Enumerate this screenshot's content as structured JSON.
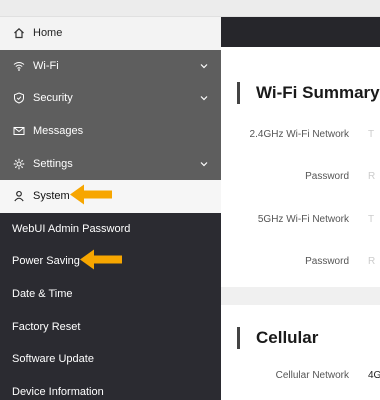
{
  "sidebar": {
    "items": [
      {
        "label": "Home",
        "icon": "home-icon"
      },
      {
        "label": "Wi-Fi",
        "icon": "wifi-icon"
      },
      {
        "label": "Security",
        "icon": "shield-icon"
      },
      {
        "label": "Messages",
        "icon": "envelope-icon"
      },
      {
        "label": "Settings",
        "icon": "gear-icon"
      },
      {
        "label": "System",
        "icon": "person-icon"
      },
      {
        "label": "WebUI Admin Password"
      },
      {
        "label": "Power Saving"
      },
      {
        "label": "Date & Time"
      },
      {
        "label": "Factory Reset"
      },
      {
        "label": "Software Update"
      },
      {
        "label": "Device Information"
      }
    ]
  },
  "wifi_summary": {
    "title": "Wi-Fi Summary",
    "rows": [
      {
        "label": "2.4GHz Wi-Fi Network",
        "value": "T"
      },
      {
        "label": "Password",
        "value": "R"
      },
      {
        "label": "5GHz Wi-Fi Network",
        "value": "T"
      },
      {
        "label": "Password",
        "value": "R"
      }
    ]
  },
  "cellular": {
    "title": "Cellular",
    "rows": [
      {
        "label": "Cellular Network",
        "value": "4G"
      }
    ]
  },
  "colors": {
    "accent_arrow": "#f7a600",
    "sidebar_bg": "#2b2b31",
    "sidebar_expanded_bg": "#5e5e5e"
  }
}
